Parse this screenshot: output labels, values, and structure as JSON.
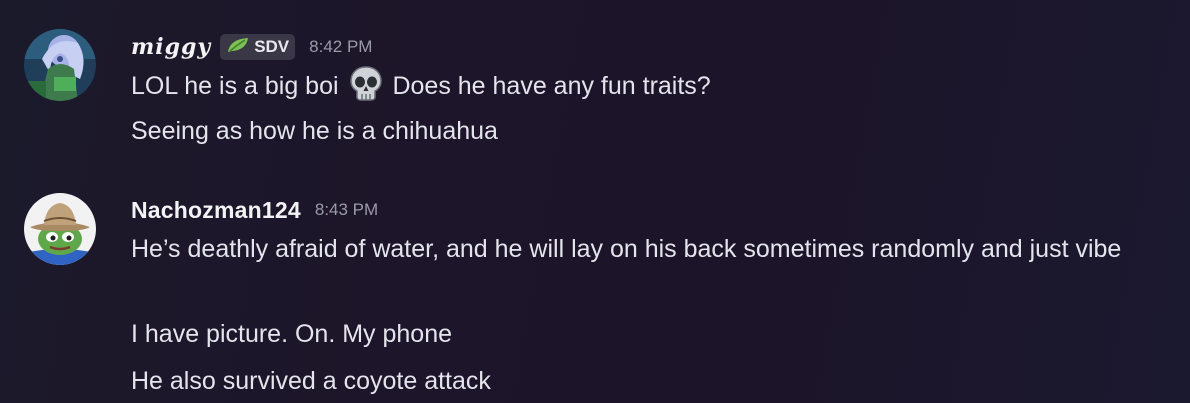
{
  "messages": [
    {
      "author": "miggy",
      "tag": "SDV",
      "tag_icon": "leaf-icon",
      "time": "8:42 PM",
      "lines": [
        {
          "before": "LOL he is a big boi",
          "emoji": "skull-emoji",
          "after": "Does he have any fun traits?"
        },
        {
          "text": "Seeing as how he is a chihuahua"
        }
      ]
    },
    {
      "author": "Nachozman124",
      "time": "8:43 PM",
      "lines": [
        {
          "text": "He’s deathly afraid of water, and he will lay on his back sometimes randomly and just vibe"
        },
        {
          "text": "I have picture. On. My phone"
        },
        {
          "text": "He also survived a coyote attack"
        }
      ]
    }
  ],
  "colors": {
    "background": "#1c1528",
    "username": "#f2f3f5",
    "timestamp": "#9a9aa8",
    "text": "#e4e4ec",
    "tag_bg": "#3a3846",
    "leaf": "#7cc151"
  }
}
